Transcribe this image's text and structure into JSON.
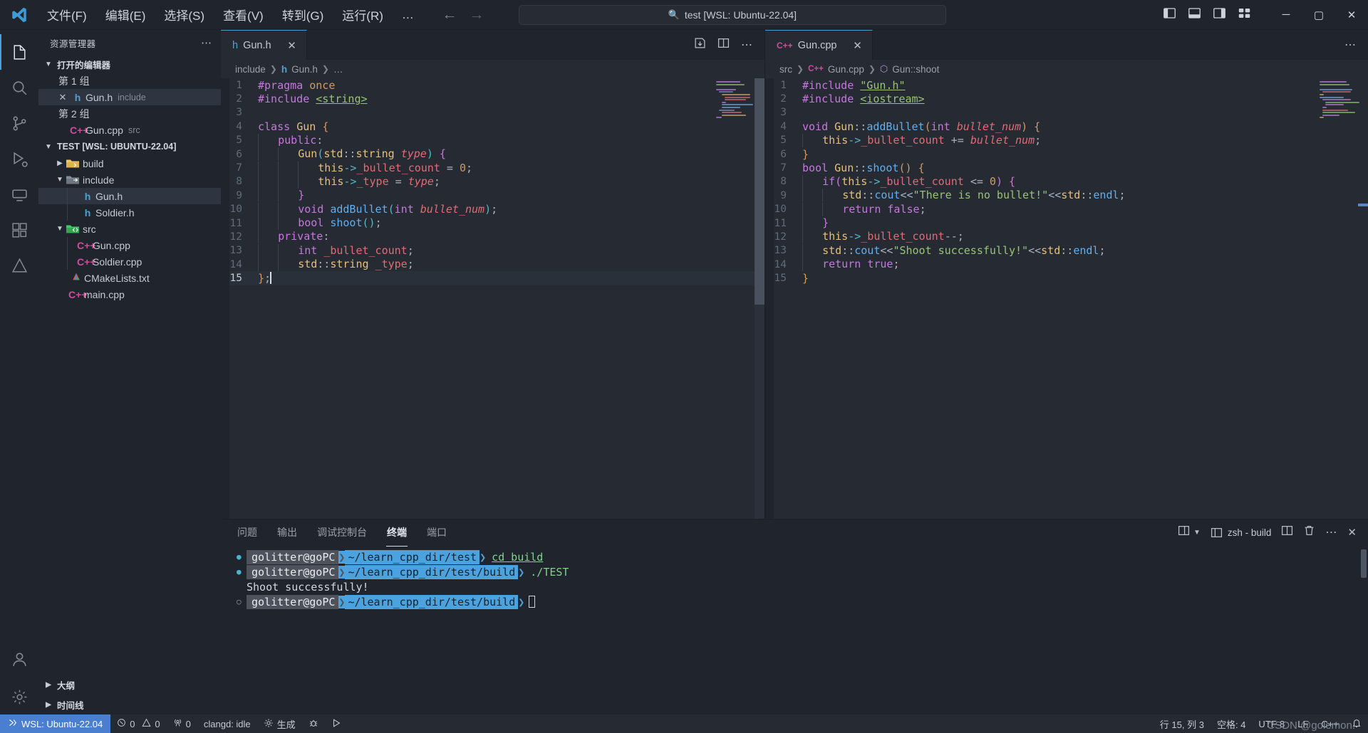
{
  "titlebar": {
    "menus": [
      "文件(F)",
      "编辑(E)",
      "选择(S)",
      "查看(V)",
      "转到(G)",
      "运行(R)"
    ],
    "more": "…",
    "back_icon": "arrow-left-icon",
    "forward_icon": "arrow-right-icon",
    "command_center": "test [WSL: Ubuntu-22.04]",
    "search_icon": "search-icon",
    "minimize": "─",
    "maximize": "▢",
    "close": "✕"
  },
  "activitybar": {
    "items": [
      {
        "name": "explorer",
        "icon": "files-icon"
      },
      {
        "name": "search",
        "icon": "search-icon"
      },
      {
        "name": "source-control",
        "icon": "source-control-icon"
      },
      {
        "name": "run-debug",
        "icon": "run-debug-icon"
      },
      {
        "name": "remote-explorer",
        "icon": "remote-explorer-icon"
      },
      {
        "name": "extensions",
        "icon": "extensions-icon"
      },
      {
        "name": "cmake",
        "icon": "cmake-icon"
      }
    ],
    "bottom": [
      {
        "name": "accounts",
        "icon": "account-icon"
      },
      {
        "name": "settings",
        "icon": "gear-icon"
      }
    ]
  },
  "sidebar": {
    "title": "资源管理器",
    "more_actions": "⋯",
    "open_editors": {
      "label": "打开的编辑器",
      "groups": [
        {
          "label": "第 1 组",
          "files": [
            {
              "name": "Gun.h",
              "desc": "include",
              "icon": "h-file-icon",
              "selected": true,
              "close": "✕"
            }
          ]
        },
        {
          "label": "第 2 组",
          "files": [
            {
              "name": "Gun.cpp",
              "desc": "src",
              "icon": "cpp-file-icon",
              "selected": false,
              "close": ""
            }
          ]
        }
      ]
    },
    "workspace": {
      "label": "TEST [WSL: UBUNTU-22.04]",
      "tree": [
        {
          "label": "build",
          "type": "folder",
          "expanded": false,
          "depth": 1,
          "icon": "folder-build-icon"
        },
        {
          "label": "include",
          "type": "folder",
          "expanded": true,
          "depth": 1,
          "icon": "folder-include-icon"
        },
        {
          "label": "Gun.h",
          "type": "file",
          "icon": "h-file-icon",
          "depth": 2,
          "selected": true
        },
        {
          "label": "Soldier.h",
          "type": "file",
          "icon": "h-file-icon",
          "depth": 2,
          "selected": false
        },
        {
          "label": "src",
          "type": "folder",
          "expanded": true,
          "depth": 1,
          "icon": "folder-src-icon"
        },
        {
          "label": "Gun.cpp",
          "type": "file",
          "icon": "cpp-file-icon",
          "depth": 2,
          "selected": false
        },
        {
          "label": "Soldier.cpp",
          "type": "file",
          "icon": "cpp-file-icon",
          "depth": 2,
          "selected": false
        },
        {
          "label": "CMakeLists.txt",
          "type": "file",
          "icon": "cmake-file-icon",
          "depth": 1,
          "selected": false
        },
        {
          "label": "main.cpp",
          "type": "file",
          "icon": "cpp-file-icon",
          "depth": 1,
          "selected": false
        }
      ]
    },
    "bottom_sections": [
      {
        "label": "大纲"
      },
      {
        "label": "时间线"
      }
    ]
  },
  "editor_groups": [
    {
      "tab": {
        "label": "Gun.h",
        "icon": "h-file-icon",
        "close": "✕",
        "active": true
      },
      "actions": [
        "save-all-icon",
        "split-editor-icon",
        "more-icon"
      ],
      "breadcrumb": [
        "include",
        "Gun.h",
        "…"
      ],
      "cursor_line": 15,
      "lines": [
        {
          "n": 1,
          "text": "#pragma once"
        },
        {
          "n": 2,
          "text": "#include <string>"
        },
        {
          "n": 3,
          "text": ""
        },
        {
          "n": 4,
          "text": "class Gun {"
        },
        {
          "n": 5,
          "text": "    public:"
        },
        {
          "n": 6,
          "text": "        Gun(std::string type) {"
        },
        {
          "n": 7,
          "text": "            this->_bullet_count = 0;"
        },
        {
          "n": 8,
          "text": "            this->_type = type;"
        },
        {
          "n": 9,
          "text": "        }"
        },
        {
          "n": 10,
          "text": "        void addBullet(int bullet_num);"
        },
        {
          "n": 11,
          "text": "        bool shoot();"
        },
        {
          "n": 12,
          "text": "    private:"
        },
        {
          "n": 13,
          "text": "        int _bullet_count;"
        },
        {
          "n": 14,
          "text": "        std::string _type;"
        },
        {
          "n": 15,
          "text": "};"
        }
      ]
    },
    {
      "tab": {
        "label": "Gun.cpp",
        "icon": "cpp-file-icon",
        "close": "✕",
        "active": true
      },
      "actions": [
        "more-icon"
      ],
      "breadcrumb": [
        "src",
        "Gun.cpp",
        "Gun::shoot"
      ],
      "cursor_line": 0,
      "lines": [
        {
          "n": 1,
          "text": "#include \"Gun.h\""
        },
        {
          "n": 2,
          "text": "#include <iostream>"
        },
        {
          "n": 3,
          "text": ""
        },
        {
          "n": 4,
          "text": "void Gun::addBullet(int bullet_num) {"
        },
        {
          "n": 5,
          "text": "    this->_bullet_count += bullet_num;"
        },
        {
          "n": 6,
          "text": "}"
        },
        {
          "n": 7,
          "text": "bool Gun::shoot() {"
        },
        {
          "n": 8,
          "text": "    if(this->_bullet_count <= 0) {"
        },
        {
          "n": 9,
          "text": "        std::cout<<\"There is no bullet!\"<<std::endl;"
        },
        {
          "n": 10,
          "text": "        return false;"
        },
        {
          "n": 11,
          "text": "    }"
        },
        {
          "n": 12,
          "text": "    this->_bullet_count--;"
        },
        {
          "n": 13,
          "text": "    std::cout<<\"Shoot successfully!\"<<std::endl;"
        },
        {
          "n": 14,
          "text": "    return true;"
        },
        {
          "n": 15,
          "text": "}"
        }
      ]
    }
  ],
  "panel": {
    "tabs": [
      "问题",
      "输出",
      "调试控制台",
      "终端",
      "端口"
    ],
    "active_tab": "终端",
    "actions": {
      "new_terminal": "new-terminal-icon",
      "dropdown": "chevron-down-icon",
      "terminal_name": "zsh - build",
      "split": "split-terminal-icon",
      "kill": "trash-icon",
      "more": "⋯",
      "close": "✕"
    },
    "terminal_lines": [
      {
        "kind": "prompt",
        "marker": "filled",
        "user": "golitter@goPC",
        "path": "~/learn_cpp_dir/test",
        "command": "cd build"
      },
      {
        "kind": "prompt",
        "marker": "filled",
        "user": "golitter@goPC",
        "path": "~/learn_cpp_dir/test/build",
        "command": "./TEST"
      },
      {
        "kind": "output",
        "text": "Shoot successfully!"
      },
      {
        "kind": "prompt",
        "marker": "hollow",
        "user": "golitter@goPC",
        "path": "~/learn_cpp_dir/test/build",
        "command": ""
      }
    ]
  },
  "statusbar": {
    "remote": "WSL: Ubuntu-22.04",
    "remote_icon": "remote-icon",
    "errors": "0",
    "warnings": "0",
    "ports": "0",
    "clangd": "clangd: idle",
    "build": "生成",
    "build_icon": "gear-icon",
    "debug_icon": "bug-icon",
    "run_icon": "play-icon",
    "line_col": "行 15, 列 3",
    "spaces": "空格: 4",
    "encoding": "UTF-8",
    "eol": "LF",
    "language": "C++",
    "bell_icon": "bell-icon",
    "watermark": "CSDN @golemon."
  },
  "colors": {
    "accent": "#4a9eda",
    "remote_bg": "#4a7fd0",
    "terminal_path": "#4aa3df",
    "bg": "#1e222a",
    "editor_bg": "#252a33",
    "sidebar_bg": "#20242c"
  }
}
